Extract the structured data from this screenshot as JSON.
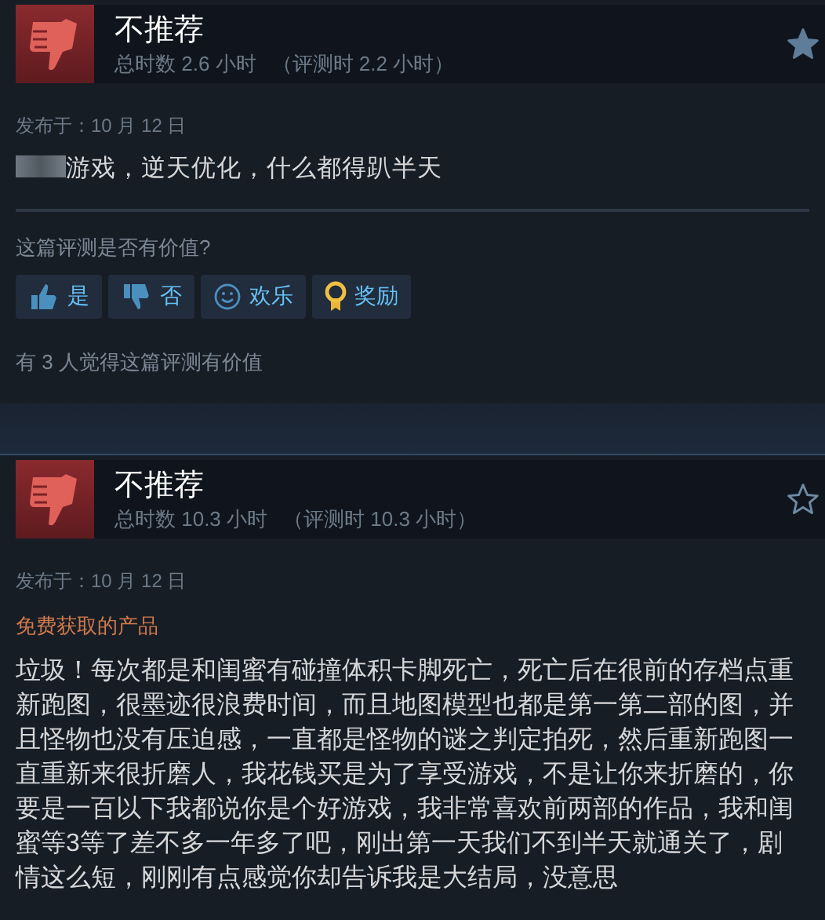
{
  "reviews": [
    {
      "verdict": "不推荐",
      "kind": "negative",
      "playtime": "总时数 2.6 小时",
      "review_time": "（评测时 2.2 小时）",
      "starred": true,
      "posted": "发布于：10 月 12 日",
      "redacted_prefix": true,
      "text": "游戏，逆天优化，什么都得趴半天",
      "helpful_prompt": "这篇评测是否有价值?",
      "vote_buttons": [
        {
          "kind": "yes",
          "label": "是"
        },
        {
          "kind": "no",
          "label": "否"
        },
        {
          "kind": "funny",
          "label": "欢乐"
        },
        {
          "kind": "award",
          "label": "奖励"
        }
      ],
      "helpful_count": "有 3 人觉得这篇评测有价值"
    },
    {
      "verdict": "不推荐",
      "kind": "negative",
      "playtime": "总时数 10.3 小时",
      "review_time": "（评测时 10.3 小时）",
      "starred": false,
      "posted": "发布于：10 月 12 日",
      "free_label": "免费获取的产品",
      "text": "垃圾！每次都是和闺蜜有碰撞体积卡脚死亡，死亡后在很前的存档点重新跑图，很墨迹很浪费时间，而且地图模型也都是第一第二部的图，并且怪物也没有压迫感，一直都是怪物的谜之判定拍死，然后重新跑图一直重新来很折磨人，我花钱买是为了享受游戏，不是让你来折磨的，你要是一百以下我都说你是个好游戏，我非常喜欢前两部的作品，我和闺蜜等3等了差不多一年多了吧，刚出第一天我们不到半天就通关了，剧情这么短，刚刚有点感觉你却告诉我是大结局，没意思"
    }
  ]
}
